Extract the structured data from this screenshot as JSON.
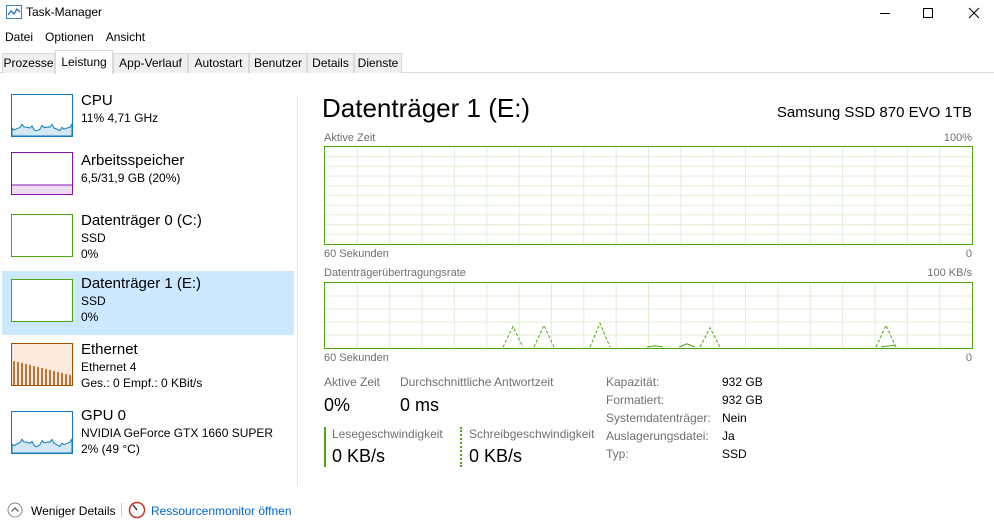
{
  "window": {
    "title": "Task-Manager"
  },
  "menu": [
    "Datei",
    "Optionen",
    "Ansicht"
  ],
  "tabs": [
    "Prozesse",
    "Leistung",
    "App-Verlauf",
    "Autostart",
    "Benutzer",
    "Details",
    "Dienste"
  ],
  "active_tab": "Leistung",
  "sidebar": {
    "items": [
      {
        "name": "CPU",
        "line1": "11% 4,71 GHz",
        "line2": "",
        "color": "#117dbb"
      },
      {
        "name": "Arbeitsspeicher",
        "line1": "6,5/31,9 GB (20%)",
        "line2": "",
        "color": "#8b12ae"
      },
      {
        "name": "Datenträger 0 (C:)",
        "line1": "SSD",
        "line2": "0%",
        "color": "#4da60c"
      },
      {
        "name": "Datenträger 1 (E:)",
        "line1": "SSD",
        "line2": "0%",
        "color": "#4da60c",
        "selected": true
      },
      {
        "name": "Ethernet",
        "line1": "Ethernet 4",
        "line2": "Ges.: 0 Empf.: 0 KBit/s",
        "color": "#a74f01"
      },
      {
        "name": "GPU 0",
        "line1": "NVIDIA GeForce GTX 1660 SUPER",
        "line2": "2% (49 °C)",
        "color": "#117dbb"
      }
    ]
  },
  "detail": {
    "title": "Datenträger 1 (E:)",
    "model": "Samsung SSD 870 EVO 1TB",
    "graph1": {
      "label": "Aktive Zeit",
      "max": "100%",
      "time": "60 Sekunden",
      "min": "0"
    },
    "graph2": {
      "label": "Datenträgerübertragungsrate",
      "max": "100 KB/s",
      "time": "60 Sekunden",
      "min": "0",
      "write_peaks": [
        0.33,
        0.35,
        0.38,
        0.31,
        0.35
      ],
      "read_peaks": [
        0.02,
        0.05
      ]
    },
    "stats": {
      "active_time_label": "Aktive Zeit",
      "active_time_value": "0%",
      "response_label": "Durchschnittliche Antwortzeit",
      "response_value": "0 ms",
      "read_label": "Lesegeschwindigkeit",
      "read_value": "0 KB/s",
      "write_label": "Schreibgeschwindigkeit",
      "write_value": "0 KB/s"
    },
    "properties": [
      {
        "label": "Kapazität:",
        "value": "932 GB"
      },
      {
        "label": "Formatiert:",
        "value": "932 GB"
      },
      {
        "label": "Systemdatenträger:",
        "value": "Nein"
      },
      {
        "label": "Auslagerungsdatei:",
        "value": "Ja"
      },
      {
        "label": "Typ:",
        "value": "SSD"
      }
    ]
  },
  "footer": {
    "less_details": "Weniger Details",
    "resource_monitor": "Ressourcenmonitor öffnen"
  },
  "colors": {
    "disk_green": "#4da60c",
    "cpu_blue": "#117dbb",
    "mem_purple": "#8b12ae",
    "eth_brown": "#a74f01",
    "selected_bg": "#cce8ff",
    "link": "#0066cc"
  }
}
